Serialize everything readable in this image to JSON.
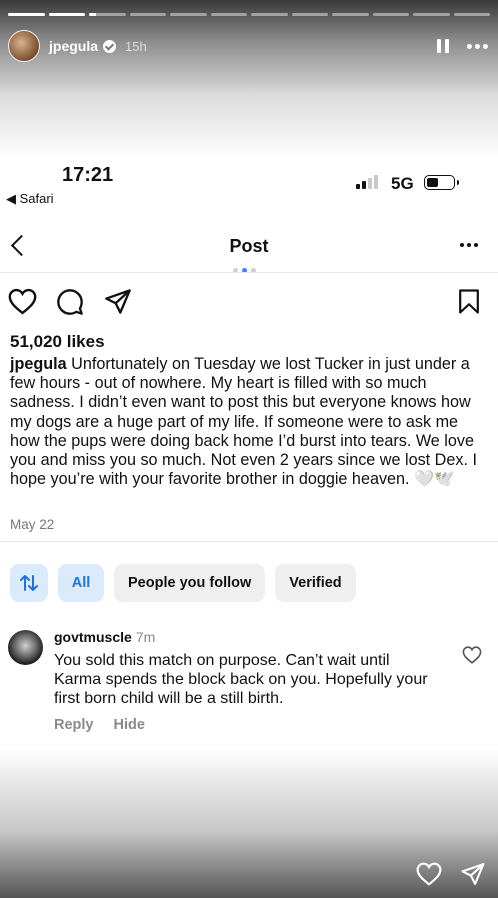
{
  "story": {
    "username": "jpegula",
    "time": "15h",
    "progress": [
      1,
      1,
      0.2,
      0,
      0,
      0,
      0,
      0,
      0,
      0,
      0,
      0
    ],
    "icons": [
      "pause-icon",
      "more-icon",
      "heart-icon",
      "send-icon",
      "verified-badge-icon"
    ]
  },
  "status_bar": {
    "time": "17:21",
    "back_app": "◀ Safari",
    "network": "5G",
    "signal_bars": 2,
    "signal_total": 4,
    "battery_level": 0.5
  },
  "nav": {
    "title": "Post"
  },
  "carousel": {
    "count": 3,
    "active_index": 1
  },
  "post": {
    "likes": "51,020 likes",
    "username": "jpegula",
    "caption": " Unfortunately on Tuesday we lost Tucker in just under a few hours - out of nowhere. My heart is filled with so much sadness. I didn’t even want to post this but everyone knows how my dogs are a huge part of my life. If someone were to ask me how the pups were doing back home I’d burst into tears. We love you and miss you so much. Not even 2 years since we lost Dex. I hope you’re with your favorite brother in doggie heaven. 🤍🕊️",
    "date": "May 22"
  },
  "filters": {
    "sort_icon": "sort-icon",
    "all": "All",
    "people_you_follow": "People you follow",
    "verified": "Verified"
  },
  "comment": {
    "username": "govtmuscle",
    "time": "7m",
    "text": "You sold this match on purpose. Can’t wait until Karma spends the block back on you. Hopefully your first born child will be a still birth.",
    "reply": "Reply",
    "hide": "Hide"
  },
  "colors": {
    "accent": "#1a73e8",
    "chip_bg": "#efefef",
    "chip_active_bg": "#dcebfb",
    "muted": "#8a8a8a"
  }
}
